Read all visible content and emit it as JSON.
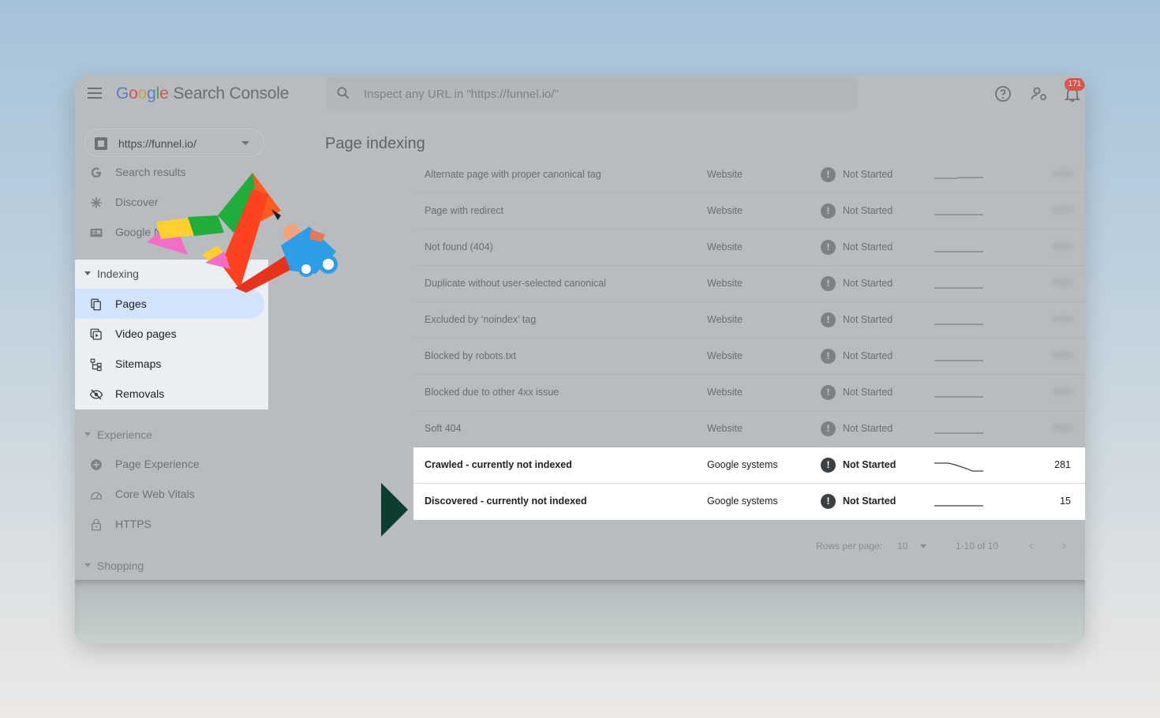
{
  "header": {
    "logo_letters": [
      "G",
      "o",
      "o",
      "g",
      "l",
      "e"
    ],
    "product": "Search Console",
    "search_placeholder": "Inspect any URL in \"https://funnel.io/\"",
    "notification_count": "171"
  },
  "sidebar": {
    "property": "https://funnel.io/",
    "top_items": [
      {
        "label": "Search results",
        "icon": "google-g-icon"
      },
      {
        "label": "Discover",
        "icon": "asterisk-icon"
      },
      {
        "label": "Google News",
        "icon": "news-icon"
      }
    ],
    "indexing": {
      "title": "Indexing",
      "items": [
        {
          "label": "Pages",
          "icon": "pages-icon"
        },
        {
          "label": "Video pages",
          "icon": "video-pages-icon"
        },
        {
          "label": "Sitemaps",
          "icon": "sitemap-icon"
        },
        {
          "label": "Removals",
          "icon": "eye-off-icon"
        }
      ]
    },
    "experience": {
      "title": "Experience",
      "items": [
        {
          "label": "Page Experience",
          "icon": "plus-circle-icon"
        },
        {
          "label": "Core Web Vitals",
          "icon": "gauge-icon"
        },
        {
          "label": "HTTPS",
          "icon": "lock-icon"
        }
      ]
    },
    "shopping": {
      "title": "Shopping"
    }
  },
  "main": {
    "title": "Page indexing",
    "rows": [
      {
        "reason": "Alternate page with proper canonical tag",
        "source": "Website",
        "validation": "Not Started"
      },
      {
        "reason": "Page with redirect",
        "source": "Website",
        "validation": "Not Started"
      },
      {
        "reason": "Not found (404)",
        "source": "Website",
        "validation": "Not Started"
      },
      {
        "reason": "Duplicate without user-selected canonical",
        "source": "Website",
        "validation": "Not Started"
      },
      {
        "reason": "Excluded by ‘noindex’ tag",
        "source": "Website",
        "validation": "Not Started"
      },
      {
        "reason": "Blocked by robots.txt",
        "source": "Website",
        "validation": "Not Started"
      },
      {
        "reason": "Blocked due to other 4xx issue",
        "source": "Website",
        "validation": "Not Started"
      },
      {
        "reason": "Soft 404",
        "source": "Website",
        "validation": "Not Started"
      },
      {
        "reason": "Crawled - currently not indexed",
        "source": "Google systems",
        "validation": "Not Started",
        "pages": "281"
      },
      {
        "reason": "Discovered - currently not indexed",
        "source": "Google systems",
        "validation": "Not Started",
        "pages": "15"
      }
    ],
    "pager": {
      "rows_per_page_label": "Rows per page:",
      "rows_per_page": "10",
      "range": "1-10 of 10"
    }
  },
  "colors": {
    "highlight_row": "#ffffff",
    "pages_selected": "#d3e3fd",
    "pointer": "#0c3d2e",
    "badge": "#d4564d"
  }
}
